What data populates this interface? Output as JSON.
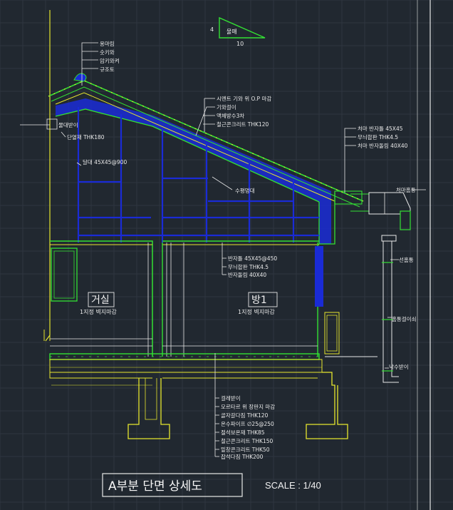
{
  "title": "A부분 단면 상세도",
  "scale": "SCALE : 1/40",
  "slope_symbol": {
    "rise": "4",
    "run": "10",
    "label": "물매"
  },
  "rooms": [
    {
      "name": "거실",
      "finish": "1지정 벽지마감"
    },
    {
      "name": "방1",
      "finish": "1지정 벽지마감"
    }
  ],
  "callouts": {
    "ridge": [
      "용마림",
      "숫키와",
      "암키와켜",
      "규조토"
    ],
    "roof": [
      "시멘트 기와 위 O.P 마감",
      "기와걸이",
      "액체방수3차",
      "철근콘크리트 THK120"
    ],
    "eave": [
      "처마 반자틀 45X45",
      "무늬합판 THK4.5",
      "처마 반자돌림 40X40"
    ],
    "ceiling": [
      "반자틀 45X45@450",
      "무늬합판 THK4.5",
      "반자돌림 40X40"
    ],
    "floor": [
      "걸레받이",
      "모르타르 위 장판지 마감",
      "골자갈다짐 THK120",
      "온수파이프 ∅25@250",
      "절석보온재 THK85",
      "철근콘크리트 THK150",
      "밑창콘크리트 THK50",
      "잡석다짐 THK200"
    ],
    "left_wall": [
      "물대받이",
      "단열재 THK180",
      "달대 45X45@900"
    ],
    "misc": {
      "suspension": "수평멍대",
      "fascia": "처마홈통",
      "downpipe": "선홈통",
      "bracket": "홈통걸이쇠",
      "splash": "낙수받이"
    }
  },
  "colors": {
    "background": "#212830",
    "structure_green": "#33e033",
    "frame_yellow": "#e6e62e",
    "framing_blue": "#1a2bd6",
    "text": "#e8e8e8",
    "grid": "#2e3640"
  }
}
